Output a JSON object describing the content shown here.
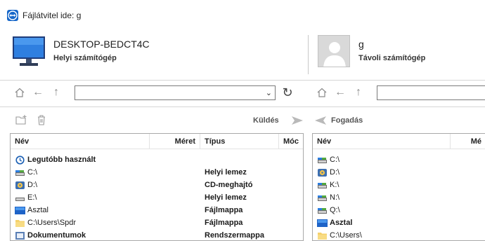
{
  "window": {
    "title": "Fájlátvitel ide: g"
  },
  "local": {
    "name": "DESKTOP-BEDCT4C",
    "subtitle": "Helyi számítógép"
  },
  "remote": {
    "name": "g",
    "subtitle": "Távoli számítógép"
  },
  "toolbar": {
    "send_label": "Küldés",
    "receive_label": "Fogadás"
  },
  "local_pane": {
    "columns": [
      "Név",
      "Méret",
      "Típus",
      "Móc"
    ],
    "rows": [
      {
        "name": "Legutóbb használt",
        "type": "",
        "icon": "recent-icon"
      },
      {
        "name": "C:\\",
        "type": "Helyi lemez",
        "icon": "drive-icon"
      },
      {
        "name": "D:\\",
        "type": "CD-meghajtó",
        "icon": "cd-drive-icon"
      },
      {
        "name": "E:\\",
        "type": "Helyi lemez",
        "icon": "drive-icon"
      },
      {
        "name": "Asztal",
        "type": "Fájlmappa",
        "icon": "desktop-icon"
      },
      {
        "name": "C:\\Users\\Spdr",
        "type": "Fájlmappa",
        "icon": "folder-icon"
      },
      {
        "name": "Dokumentumok",
        "type": "Rendszermappa",
        "icon": "documents-icon"
      }
    ]
  },
  "remote_pane": {
    "columns": [
      "Név",
      "Mé"
    ],
    "rows": [
      {
        "name": "C:\\",
        "icon": "drive-icon"
      },
      {
        "name": "D:\\",
        "icon": "cd-drive-icon"
      },
      {
        "name": "K:\\",
        "icon": "drive-icon"
      },
      {
        "name": "N:\\",
        "icon": "network-drive-icon"
      },
      {
        "name": "Q:\\",
        "icon": "network-drive-icon"
      },
      {
        "name": "Asztal",
        "icon": "desktop-icon"
      },
      {
        "name": "C:\\Users\\",
        "icon": "folder-icon"
      }
    ]
  },
  "colors": {
    "accent": "#1767c9",
    "border": "#a9a9a9",
    "muted_icon": "#9a9a9a"
  }
}
